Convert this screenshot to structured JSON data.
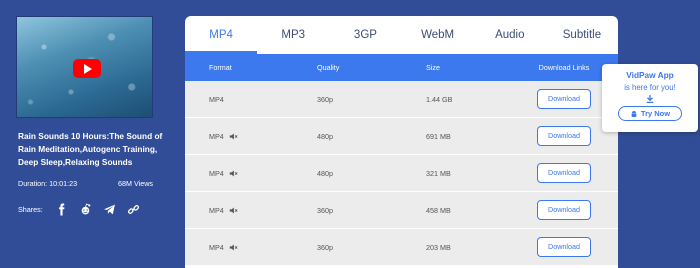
{
  "video": {
    "title": "Rain Sounds 10 Hours:The Sound of Rain Meditation,Autogenc Training, Deep Sleep,Relaxing Sounds",
    "duration": "Duration: 10:01:23",
    "views": "68M Views",
    "shares_label": "Shares:"
  },
  "tabs": [
    "MP4",
    "MP3",
    "3GP",
    "WebM",
    "Audio",
    "Subtitle"
  ],
  "table": {
    "headers": {
      "format": "Format",
      "quality": "Quality",
      "size": "Size",
      "download": "Download Links"
    },
    "rows": [
      {
        "format": "MP4",
        "muted": false,
        "quality": "360p",
        "size": "1.44 GB",
        "button": "Download"
      },
      {
        "format": "MP4",
        "muted": true,
        "quality": "480p",
        "size": "691 MB",
        "button": "Download"
      },
      {
        "format": "MP4",
        "muted": true,
        "quality": "480p",
        "size": "321 MB",
        "button": "Download"
      },
      {
        "format": "MP4",
        "muted": true,
        "quality": "360p",
        "size": "458 MB",
        "button": "Download"
      },
      {
        "format": "MP4",
        "muted": true,
        "quality": "360p",
        "size": "203 MB",
        "button": "Download"
      }
    ]
  },
  "promo": {
    "title": "VidPaw App",
    "subtitle": "is here for you!",
    "button": "Try Now"
  },
  "colors": {
    "background": "#314d97",
    "accent": "#3c78ee",
    "row_bg": "#ececec"
  }
}
